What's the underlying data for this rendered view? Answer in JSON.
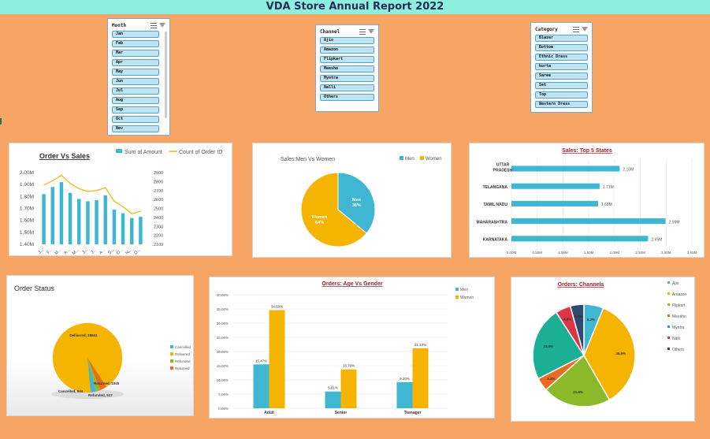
{
  "title": "VDA Store Annual Report 2022",
  "slicers": {
    "month": {
      "title": "Month",
      "items": [
        "Jan",
        "Feb",
        "Mar",
        "Apr",
        "May",
        "Jun",
        "Jul",
        "Aug",
        "Sep",
        "Oct",
        "Nov"
      ]
    },
    "channel": {
      "title": "Channel",
      "items": [
        "Ajio",
        "Amazon",
        "Flipkart",
        "Meesho",
        "Myntra",
        "Nalli",
        "Others"
      ]
    },
    "category": {
      "title": "Category",
      "items": [
        "Blazer",
        "Bottom",
        "Ethnic Dress",
        "kurta",
        "Saree",
        "Set",
        "Top",
        "Western Dress"
      ]
    }
  },
  "chart_data": [
    {
      "type": "bar",
      "title": "Order Vs Sales",
      "legend": [
        "Sum of Amount",
        "Count of Order ID"
      ],
      "categories": [
        "J...",
        "F...",
        "M...",
        "A...",
        "M...",
        "J...",
        "J...",
        "A...",
        "S...",
        "O...",
        "N...",
        "D..."
      ],
      "series": [
        {
          "name": "Sum of Amount",
          "values": [
            1.82,
            1.88,
            1.92,
            1.83,
            1.78,
            1.76,
            1.77,
            1.81,
            1.69,
            1.66,
            1.62,
            1.63
          ]
        },
        {
          "name": "Count of Order ID",
          "values": [
            2760,
            2810,
            2870,
            2780,
            2720,
            2690,
            2700,
            2730,
            2580,
            2520,
            2440,
            2470
          ]
        }
      ],
      "y_ticks": [
        "2.00M",
        "1.90M",
        "1.80M",
        "1.70M",
        "1.60M",
        "1.50M",
        "1.40M"
      ],
      "y2_ticks": [
        "2900",
        "2800",
        "2700",
        "2600",
        "2500",
        "2400",
        "2300",
        "2200",
        "2100"
      ],
      "ylim": [
        1.4,
        2.0
      ],
      "y2lim": [
        2100,
        2900
      ]
    },
    {
      "type": "pie",
      "title": "Sales:Men Vs Women",
      "legend": [
        "Men",
        "Women"
      ],
      "labels": [
        "Men",
        "Women"
      ],
      "values": [
        36,
        64
      ],
      "value_labels": [
        "36%",
        "64%"
      ]
    },
    {
      "type": "bar",
      "title": "Sales: Top 5 States",
      "categories": [
        "UTTAR PRADESH",
        "TELANGANA",
        "TAMIL NADU",
        "MAHARASHTRA",
        "KARNATAKA"
      ],
      "values": [
        2.1,
        1.71,
        1.68,
        2.99,
        2.65
      ],
      "value_labels": [
        "2.10M",
        "1.71M",
        "1.68M",
        "2.99M",
        "2.65M"
      ],
      "x_ticks": [
        "0.00M",
        "0.50M",
        "1.00M",
        "1.50M",
        "2.00M",
        "2.50M",
        "3.00M",
        "3.50M"
      ],
      "xlim": [
        0,
        3.5
      ]
    },
    {
      "type": "pie",
      "title": "Order Status",
      "legend": [
        "Cancelled",
        "Delivered",
        "Refunded",
        "Returned"
      ],
      "labels": [
        "Delivered",
        "Returned",
        "Refunded",
        "Cancelled"
      ],
      "values": [
        28641,
        1045,
        517,
        844
      ],
      "value_labels": [
        "Delivered, 28641",
        "Returned, 1045",
        "Refunded, 517",
        "Cancelled, 844"
      ]
    },
    {
      "type": "bar",
      "title": "Orders: Age Vs Gender",
      "legend": [
        "Men",
        "Women"
      ],
      "categories": [
        "Adult",
        "Senior",
        "Teenager"
      ],
      "series": [
        {
          "name": "Men",
          "values": [
            15.47,
            5.91,
            9.2
          ]
        },
        {
          "name": "Women",
          "values": [
            34.59,
            13.7,
            21.13
          ]
        }
      ],
      "value_labels": [
        [
          "15.47%",
          "5.91%",
          "9.20%"
        ],
        [
          "34.59%",
          "13.70%",
          "21.13%"
        ]
      ],
      "y_ticks": [
        "40.00%",
        "35.00%",
        "30.00%",
        "25.00%",
        "20.00%",
        "15.00%",
        "10.00%",
        "5.00%",
        "0.00%"
      ],
      "ylim": [
        0,
        40
      ]
    },
    {
      "type": "pie",
      "title": "Orders: Channels",
      "legend": [
        "Ajio",
        "Amazon",
        "Flipkart",
        "Meesho",
        "Myntra",
        "Nalli",
        "Others"
      ],
      "values": [
        6.2,
        35.5,
        21.6,
        4.2,
        23.4,
        4.8,
        4.3
      ],
      "value_labels": [
        "6.2%",
        "35.5%",
        "21.6%",
        "4.2%",
        "23.4%",
        "4.8%",
        "4.3%"
      ]
    }
  ],
  "colors": {
    "background": "#F7A564",
    "title_bar": "#8FEFDF",
    "blue": "#3FB7D3",
    "gold": "#F4B400",
    "green": "#8CB92A",
    "orange": "#E86B20",
    "teal": "#1BAF96",
    "red": "#DC3545",
    "navy": "#2F4A6E"
  }
}
